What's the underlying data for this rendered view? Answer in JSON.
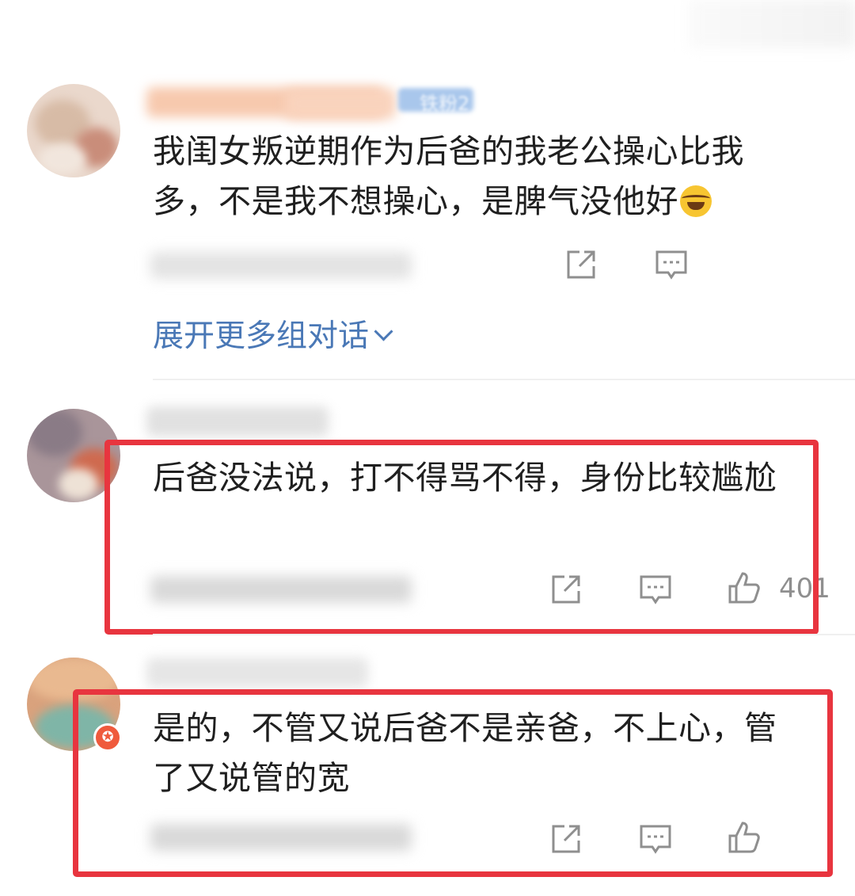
{
  "comments": [
    {
      "text": "我闺女叛逆期作为后爸的我老公操心比我多，不是我不想操心，是脾气没他好",
      "emoji_icon": "laughing-tears-emoji",
      "badge": "铁粉2",
      "actions": {
        "share_icon": "share-icon",
        "reply_icon": "comment-icon"
      }
    },
    {
      "text": "后爸没法说，打不得骂不得，身份比较尴尬",
      "like_count": "401",
      "actions": {
        "share_icon": "share-icon",
        "reply_icon": "comment-icon",
        "like_icon": "thumbs-up-icon"
      }
    },
    {
      "text": "是的，不管又说后爸不是亲爸，不上心，管了又说管的宽",
      "actions": {
        "share_icon": "share-icon",
        "reply_icon": "comment-icon",
        "like_icon": "thumbs-up-icon"
      }
    }
  ],
  "expand_link": "展开更多组对话",
  "colors": {
    "highlight": "#e8353f",
    "link": "#4a78b6",
    "icon": "#8f8f8f"
  }
}
